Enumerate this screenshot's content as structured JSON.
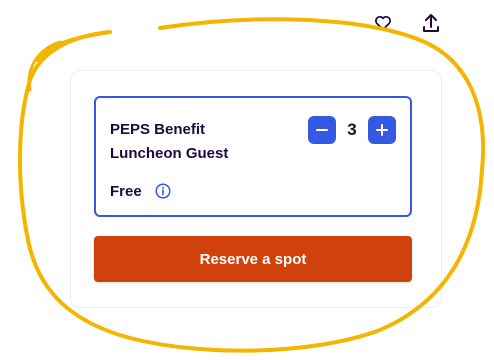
{
  "actions": {
    "like_icon": "heart-outline-icon",
    "share_icon": "share-upload-icon"
  },
  "ticket": {
    "name": "PEPS Benefit Luncheon Guest",
    "price": "Free",
    "quantity": "3",
    "info_icon": "info-circle-icon",
    "decrement_icon": "minus-icon",
    "increment_icon": "plus-icon"
  },
  "reserve_button": {
    "label": "Reserve a spot"
  },
  "colors": {
    "accent_blue": "#3659e3",
    "reserve_orange": "#d1410c",
    "annotation_yellow": "#f4b400",
    "text_dark": "#1e0a3c"
  }
}
